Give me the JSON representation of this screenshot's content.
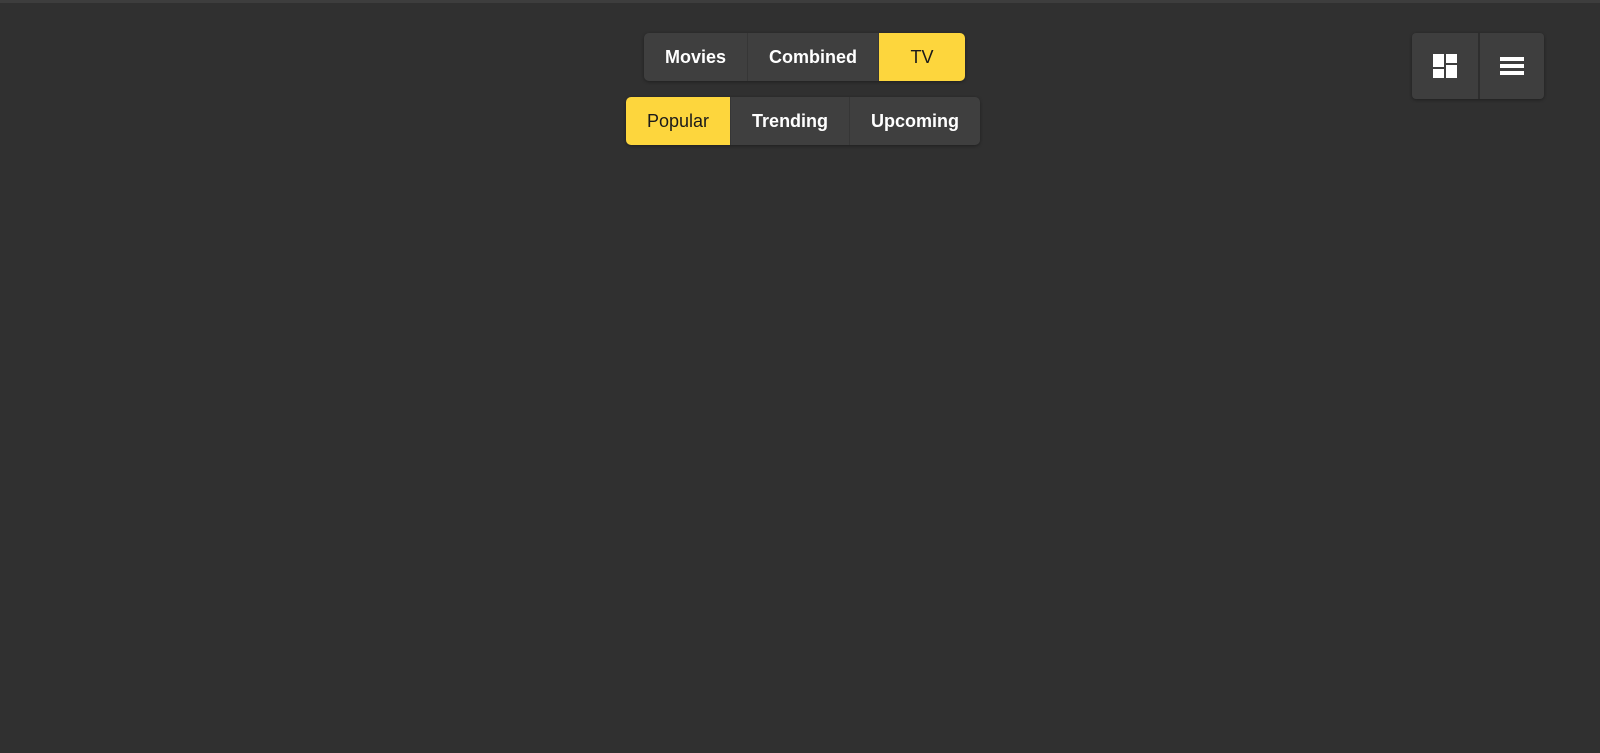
{
  "media_tabs": [
    {
      "label": "Movies",
      "active": false
    },
    {
      "label": "Combined",
      "active": false
    },
    {
      "label": "TV",
      "active": true
    }
  ],
  "category_tabs": [
    {
      "label": "Popular",
      "active": true
    },
    {
      "label": "Trending",
      "active": false
    },
    {
      "label": "Upcoming",
      "active": false
    }
  ],
  "view_toggle": {
    "grid_icon": "dashboard-grid-icon",
    "list_icon": "list-icon"
  },
  "colors": {
    "background": "#303030",
    "button": "#3f3f3f",
    "accent": "#fdd63d",
    "text": "#ffffff"
  }
}
